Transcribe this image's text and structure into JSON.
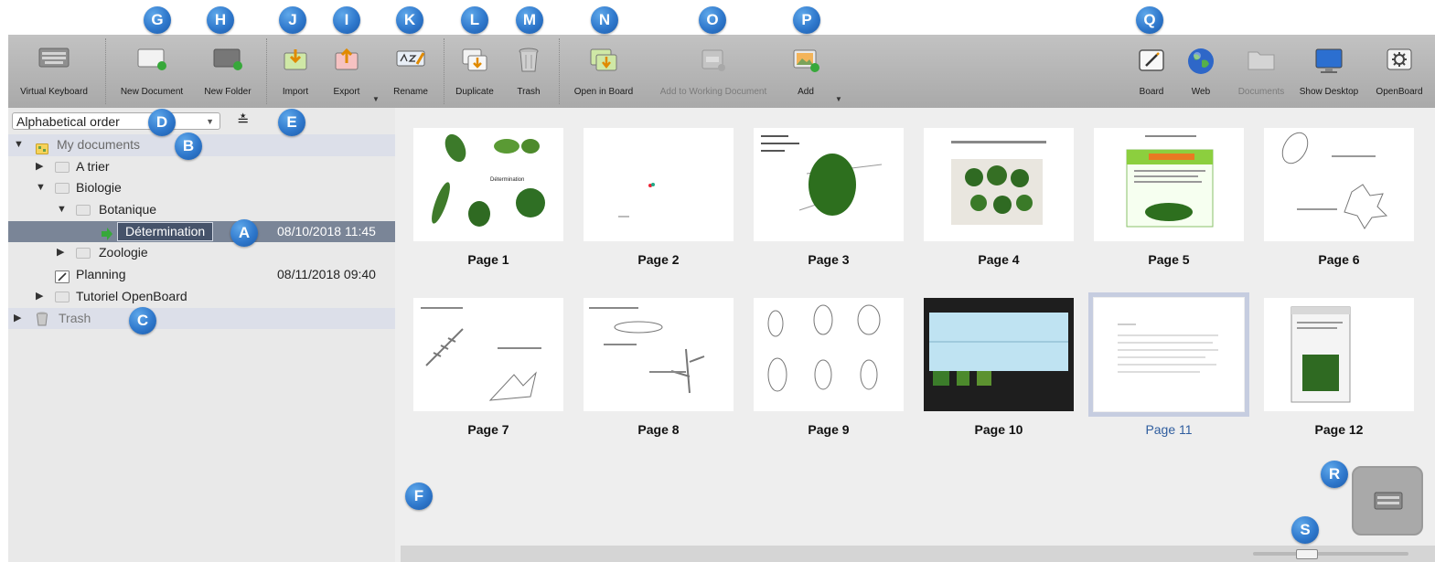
{
  "callouts": {
    "A": "A",
    "B": "B",
    "C": "C",
    "D": "D",
    "E": "E",
    "F": "F",
    "G": "G",
    "H": "H",
    "J": "J",
    "I": "I",
    "K": "K",
    "L": "L",
    "M": "M",
    "N": "N",
    "O": "O",
    "P": "P",
    "Q": "Q",
    "R": "R",
    "S": "S"
  },
  "toolbar": {
    "virtual_keyboard": "Virtual Keyboard",
    "new_document": "New Document",
    "new_folder": "New Folder",
    "import": "Import",
    "export": "Export",
    "rename": "Rename",
    "duplicate": "Duplicate",
    "trash": "Trash",
    "open_in_board": "Open in Board",
    "add_to_working_document": "Add to Working Document",
    "add": "Add",
    "board": "Board",
    "web": "Web",
    "documents": "Documents",
    "show_desktop": "Show Desktop",
    "openboard": "OpenBoard"
  },
  "sort": {
    "selected": "Alphabetical order"
  },
  "tree": {
    "my_documents": "My documents",
    "a_trier": "A trier",
    "biologie": "Biologie",
    "botanique": "Botanique",
    "determination": "Détermination",
    "determination_date": "08/10/2018 11:45",
    "zoologie": "Zoologie",
    "planning": "Planning",
    "planning_date": "08/11/2018 09:40",
    "tutoriel": "Tutoriel OpenBoard",
    "trash": "Trash"
  },
  "pages": [
    {
      "label": "Page 1"
    },
    {
      "label": "Page 2"
    },
    {
      "label": "Page 3"
    },
    {
      "label": "Page 4"
    },
    {
      "label": "Page 5"
    },
    {
      "label": "Page 6"
    },
    {
      "label": "Page 7"
    },
    {
      "label": "Page 8"
    },
    {
      "label": "Page 9"
    },
    {
      "label": "Page 10"
    },
    {
      "label": "Page 11"
    },
    {
      "label": "Page 12"
    }
  ],
  "selected_page_index": 10,
  "colors": {
    "badge": "#2f78cc",
    "toolbar": "#b3b3b3",
    "selection": "#7a8597",
    "accent_green": "#37a83a"
  }
}
